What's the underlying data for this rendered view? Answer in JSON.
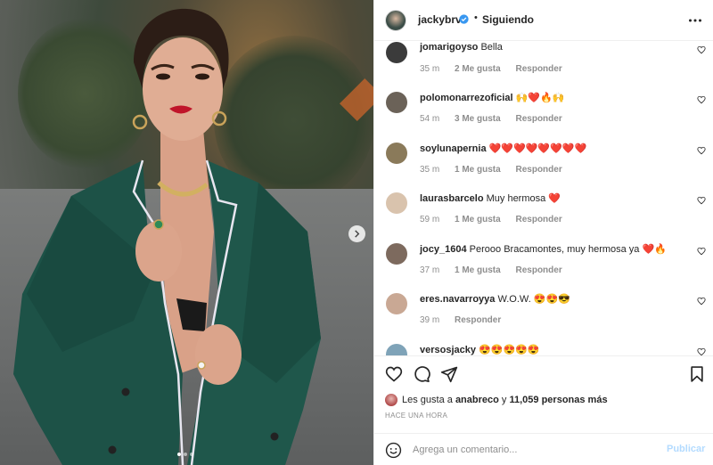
{
  "post": {
    "photo": {
      "carousel_dots": 3,
      "active_dot": 0,
      "next_icon": "chevron-right-icon"
    },
    "header": {
      "username": "jackybrv",
      "verified_icon": "verified-badge-icon",
      "separator": "•",
      "follow_status": "Siguiendo",
      "more_icon": "more-horizontal-icon"
    },
    "comments": [
      {
        "user": "jomarigoyso",
        "text": "Bella",
        "time": "35 m",
        "likes": "2 Me gusta",
        "reply": "Responder",
        "avatar_color": "#3b3b3b"
      },
      {
        "user": "polomonarrezoficial",
        "text": "🙌❤️🔥🙌",
        "time": "54 m",
        "likes": "3 Me gusta",
        "reply": "Responder",
        "avatar_color": "#6b6258"
      },
      {
        "user": "soylunapernia",
        "text": "❤️❤️❤️❤️❤️❤️❤️❤️",
        "time": "35 m",
        "likes": "1 Me gusta",
        "reply": "Responder",
        "avatar_color": "#8a7a5a"
      },
      {
        "user": "laurasbarcelo",
        "text": "Muy hermosa ❤️",
        "time": "59 m",
        "likes": "1 Me gusta",
        "reply": "Responder",
        "avatar_color": "#d9c3ad"
      },
      {
        "user": "jocy_1604",
        "text": "Perooo Bracamontes, muy hermosa ya ❤️🔥",
        "time": "37 m",
        "likes": "1 Me gusta",
        "reply": "Responder",
        "avatar_color": "#7d6a5e"
      },
      {
        "user": "eres.navarroyya",
        "text": "W.O.W. 😍😍😎",
        "time": "39 m",
        "likes": "",
        "reply": "Responder",
        "avatar_color": "#c9a894"
      },
      {
        "user": "versosjacky",
        "text": "😍😍😍😍😍",
        "time": "",
        "likes": "",
        "reply": "",
        "avatar_color": "#7fa3b8"
      }
    ],
    "actions": {
      "like_icon": "heart-icon",
      "comment_icon": "comment-icon",
      "share_icon": "send-icon",
      "save_icon": "bookmark-icon",
      "likes_prefix": "Les gusta a",
      "likes_user": "anabreco",
      "likes_joiner": "y",
      "likes_others": "11,059 personas más",
      "timestamp": "HACE UNA HORA"
    },
    "composer": {
      "emoji_icon": "emoji-icon",
      "placeholder": "Agrega un comentario...",
      "post_label": "Publicar",
      "post_color": "#b3dbff"
    }
  }
}
